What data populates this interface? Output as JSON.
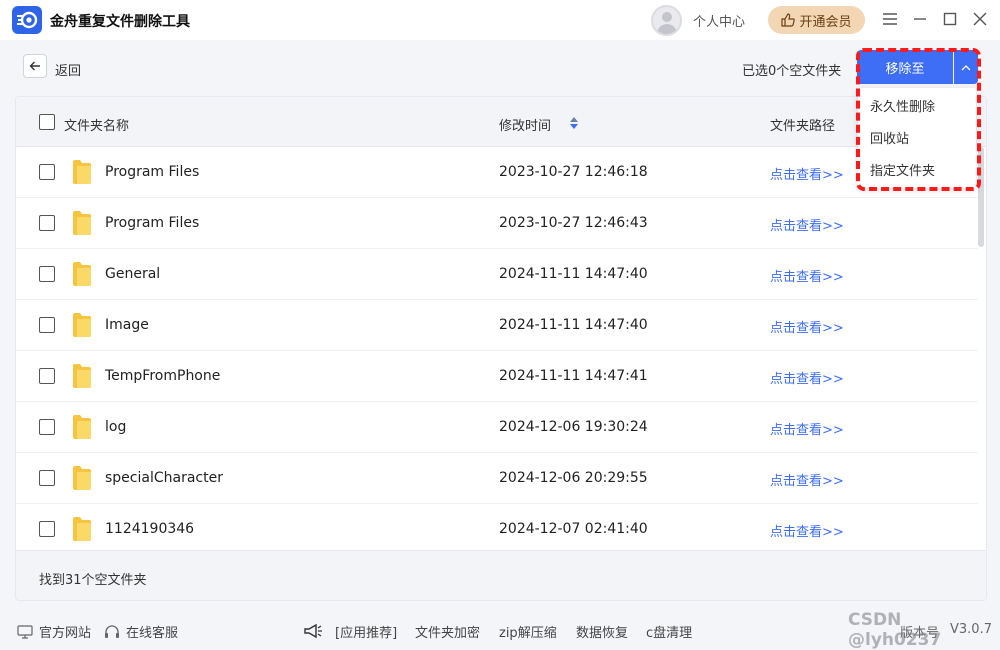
{
  "app": {
    "title": "金舟重复文件删除工具"
  },
  "header": {
    "user_center": "个人中心",
    "vip_button": "开通会员"
  },
  "toolbar": {
    "back_label": "返回",
    "selected_info": "已选0个空文件夹",
    "move_button": "移除至"
  },
  "dropdown": {
    "items": [
      {
        "label": "永久性删除"
      },
      {
        "label": "回收站"
      },
      {
        "label": "指定文件夹"
      }
    ]
  },
  "table": {
    "columns": {
      "name": "文件夹名称",
      "mtime": "修改时间",
      "path": "文件夹路径"
    },
    "rows": [
      {
        "name": "Program Files",
        "mtime": "2023-10-27 12:46:18",
        "path": "点击查看>>"
      },
      {
        "name": "Program Files",
        "mtime": "2023-10-27 12:46:43",
        "path": "点击查看>>"
      },
      {
        "name": "General",
        "mtime": "2024-11-11 14:47:40",
        "path": "点击查看>>"
      },
      {
        "name": "Image",
        "mtime": "2024-11-11 14:47:40",
        "path": "点击查看>>"
      },
      {
        "name": "TempFromPhone",
        "mtime": "2024-11-11 14:47:41",
        "path": "点击查看>>"
      },
      {
        "name": "log",
        "mtime": "2024-12-06 19:30:24",
        "path": "点击查看>>"
      },
      {
        "name": "specialCharacter",
        "mtime": "2024-12-06 20:29:55",
        "path": "点击查看>>"
      },
      {
        "name": "1124190346",
        "mtime": "2024-12-07 02:41:40",
        "path": "点击查看>>"
      }
    ],
    "footer": "找到31个空文件夹"
  },
  "footer": {
    "official_site": "官方网站",
    "online_service": "在线客服",
    "links": [
      "[应用推荐]",
      "文件夹加密",
      "zip解压缩",
      "数据恢复",
      "c盘清理"
    ],
    "version_label": "版本号",
    "version": "V3.0.7",
    "watermark": "CSDN @lyh0237"
  },
  "colors": {
    "accent": "#3d6ef5",
    "highlight": "#ff1a1a",
    "vip": "#f3d6b3"
  }
}
